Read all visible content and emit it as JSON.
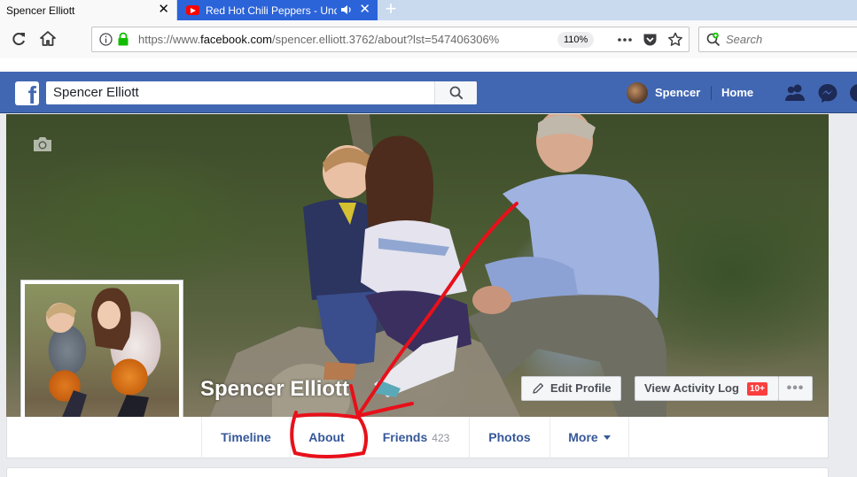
{
  "browser": {
    "tabs": [
      {
        "label": "Spencer Elliott",
        "active": true
      },
      {
        "label": "Red Hot Chili Peppers - Und",
        "active": false,
        "icon": "youtube-icon",
        "audio_icon": "speaker-icon"
      }
    ],
    "new_tab_symbol": "+",
    "url_prefix": "https://www.",
    "url_domain": "facebook.com",
    "url_suffix": "/spencer.elliott.3762/about?lst=547406306%",
    "zoom": "110%",
    "search_placeholder": "Search"
  },
  "facebook": {
    "search_value": "Spencer Elliott",
    "nav_user": "Spencer",
    "nav_home": "Home",
    "brand_color": "#4267b2",
    "icons": [
      "friend-requests-icon",
      "messenger-icon",
      "notifications-icon"
    ]
  },
  "profile": {
    "name": "Spencer Elliott",
    "edit_profile": "Edit Profile",
    "activity_log": "View Activity Log",
    "activity_badge": "10+",
    "more_dots": "•••",
    "tabs": {
      "timeline": "Timeline",
      "about": "About",
      "friends": "Friends",
      "friends_count": "423",
      "photos": "Photos",
      "more": "More"
    }
  },
  "annotation": {
    "color": "#e8101a",
    "description_icon": "hand-drawn-arrow"
  }
}
